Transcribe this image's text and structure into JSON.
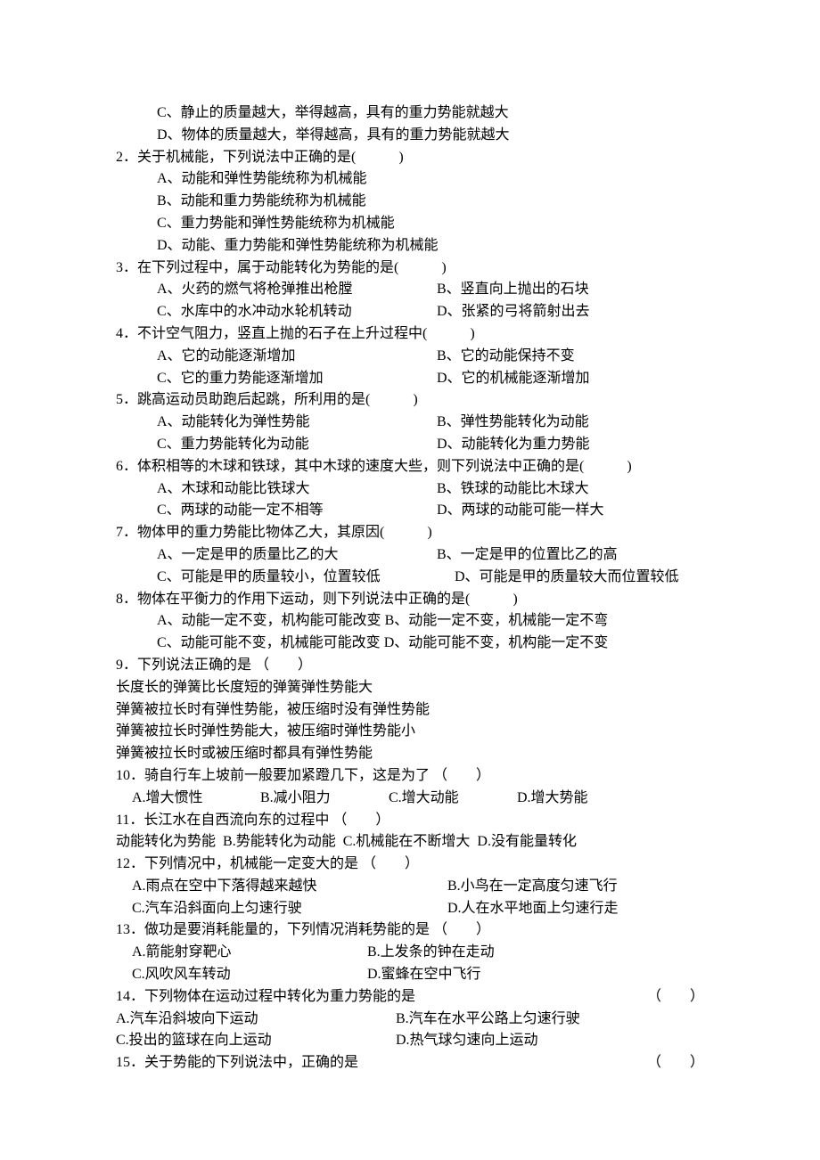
{
  "q1": {
    "C": "C、静止的质量越大，举得越高，具有的重力势能就越大",
    "D": "D、物体的质量越大，举得越高，具有的重力势能就越大"
  },
  "q2": {
    "stem": "2．关于机械能，下列说法中正确的是(　　　)",
    "A": "A、动能和弹性势能统称为机械能",
    "B": "B、动能和重力势能统称为机械能",
    "C": "C、重力势能和弹性势能统称为机械能",
    "D": "D、动能、重力势能和弹性势能统称为机械能"
  },
  "q3": {
    "stem": "3．在下列过程中，属于动能转化为势能的是(　　　)",
    "A": "A、火药的燃气将枪弹推出枪膛",
    "B": "B、竖直向上抛出的石块",
    "C": "C、水库中的水冲动水轮机转动",
    "D": "D、张紧的弓将箭射出去"
  },
  "q4": {
    "stem": "4．不计空气阻力，竖直上抛的石子在上升过程中(　　　)",
    "A": "A、它的动能逐渐增加",
    "B": "B、它的动能保持不变",
    "C": "C、它的重力势能逐渐增加",
    "D": "D、它的机械能逐渐增加"
  },
  "q5": {
    "stem": "5．跳高运动员助跑后起跳，所利用的是(　　　)",
    "A": "A、动能转化为弹性势能",
    "B": "B、弹性势能转化为动能",
    "C": "C、重力势能转化为动能",
    "D": "D、动能转化为重力势能"
  },
  "q6": {
    "stem": "6．体积相等的木球和铁球，其中木球的速度大些，则下列说法中正确的是(　　　)",
    "A": "A、木球和动能比铁球大",
    "B": "B、铁球的动能比木球大",
    "C": "C、两球的动能一定不相等",
    "D": "D、两球的动能可能一样大"
  },
  "q7": {
    "stem": "7．物体甲的重力势能比物体乙大，其原因(　　　)",
    "A": "A、一定是甲的质量比乙的大",
    "B": "B、一定是甲的位置比乙的高",
    "C": "C、可能是甲的质量较小，位置较低",
    "D": "D、可能是甲的质量较大而位置较低"
  },
  "q8": {
    "stem": "8．物体在平衡力的作用下运动，则下列说法中正确的是(　　　)",
    "A": "A、动能一定不变，机构能可能改变",
    "B": "B、动能一定不变，机械能一定不弯",
    "C": "C、动能可能不变，机械能可能改变",
    "D": "D、动能可能不变，机构能一定不变"
  },
  "q9": {
    "stem": "9．下列说法正确的是 （　　）",
    "A": "长度长的弹簧比长度短的弹簧弹性势能大",
    "B": "弹簧被拉长时有弹性势能，被压缩时没有弹性势能",
    "C": "弹簧被拉长时弹性势能大，被压缩时弹性势能小",
    "D": "弹簧被拉长时或被压缩时都具有弹性势能"
  },
  "q10": {
    "stem": "10．骑自行车上坡前一般要加紧蹬几下，这是为了 （　　）",
    "A": "A.增大惯性",
    "B": "B.减小阻力",
    "C": "C.增大动能",
    "D": "D.增大势能"
  },
  "q11": {
    "stem": "11．长江水在自西流向东的过程中 （　　）",
    "A": "动能转化为势能",
    "B": "B.势能转化为动能",
    "C": "C.机械能在不断增大",
    "D": "D.没有能量转化"
  },
  "q12": {
    "stem": "12．下列情况中，机械能一定变大的是 （　　）",
    "A": "A.雨点在空中下落得越来越快",
    "B": "B.小鸟在一定高度匀速飞行",
    "C": "C.汽车沿斜面向上匀速行驶",
    "D": "D.人在水平地面上匀速行走"
  },
  "q13": {
    "stem": "13．做功是要消耗能量的，下列情况消耗势能的是 （　　）",
    "A": "A.箭能射穿靶心",
    "B": "B.上发条的钟在走动",
    "C": "C.风吹风车转动",
    "D": "D.蜜蜂在空中飞行"
  },
  "q14": {
    "stem": "14．下列物体在运动过程中转化为重力势能的是",
    "paren": "（　　）",
    "A": "A.汽车沿斜坡向下运动",
    "B": "B.汽车在水平公路上匀速行驶",
    "C": "C.投出的篮球在向上运动",
    "D": "D.热气球匀速向上运动"
  },
  "q15": {
    "stem": "15．关于势能的下列说法中，正确的是",
    "paren": "（　　）"
  }
}
